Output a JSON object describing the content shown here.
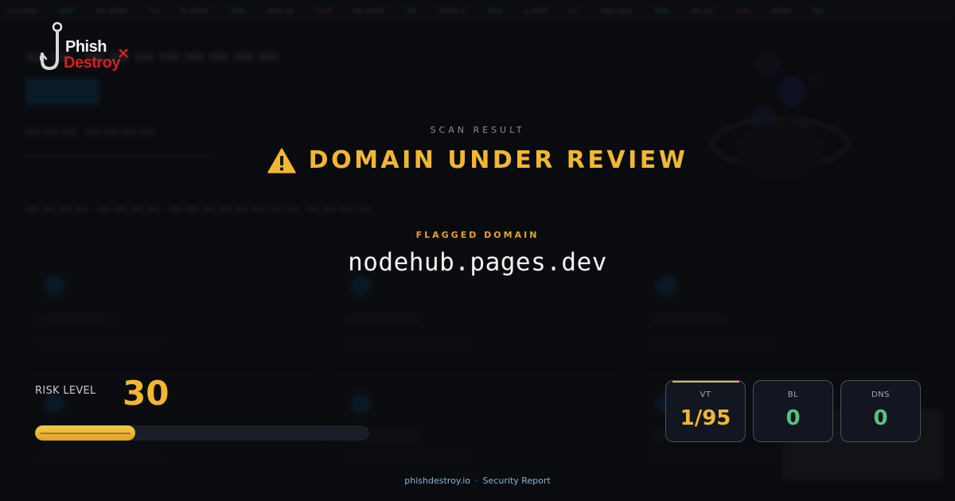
{
  "scan_label": "SCAN RESULT",
  "verdict": {
    "text": "DOMAIN UNDER REVIEW",
    "icon": "warning-triangle-icon",
    "color": "#f2b731"
  },
  "flagged_label": "FLAGGED DOMAIN",
  "domain": "nodehub.pages.dev",
  "risk": {
    "label": "RISK LEVEL",
    "score": "30",
    "fraction": 0.3
  },
  "stats": [
    {
      "label": "VT",
      "value": "1/95",
      "color": "#f2b731"
    },
    {
      "label": "BL",
      "value": "0",
      "color": "#58c27d"
    },
    {
      "label": "DNS",
      "value": "0",
      "color": "#58c27d"
    }
  ],
  "footer": {
    "site": "phishdestroy.io",
    "separator": "·",
    "report": "Security Report"
  },
  "logo": {
    "line1": "Phish",
    "line2": "Destroy",
    "icon": "fishhook-icon"
  },
  "colors": {
    "accent": "#f2b731",
    "success": "#58c27d",
    "brand_red": "#d42020"
  }
}
